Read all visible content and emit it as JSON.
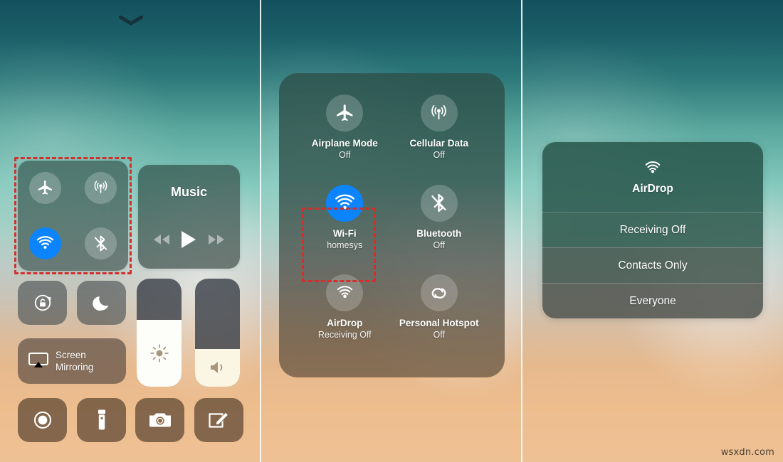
{
  "watermark": "wsxdn.com",
  "panel1": {
    "chevron_icon": "chevron-down-icon",
    "toggles": [
      {
        "id": "airplane",
        "icon": "airplane-icon",
        "state": "off"
      },
      {
        "id": "cellular",
        "icon": "cellular-antenna-icon",
        "state": "off"
      },
      {
        "id": "wifi",
        "icon": "wifi-icon",
        "state": "on"
      },
      {
        "id": "bluetooth",
        "icon": "bluetooth-off-icon",
        "state": "off"
      }
    ],
    "music": {
      "title": "Music",
      "prev_icon": "rewind-icon",
      "play_icon": "play-icon",
      "next_icon": "fast-forward-icon"
    },
    "rotation_lock": {
      "icon": "rotation-lock-icon"
    },
    "do_not_disturb": {
      "icon": "moon-icon"
    },
    "screen_mirroring": {
      "icon": "airplay-icon",
      "line1": "Screen",
      "line2": "Mirroring"
    },
    "brightness": {
      "icon": "brightness-sun-icon",
      "level_percent": 62
    },
    "volume": {
      "icon": "speaker-icon",
      "level_percent": 35
    },
    "bottom_row": [
      {
        "id": "screen-record",
        "icon": "screen-record-icon"
      },
      {
        "id": "flashlight",
        "icon": "flashlight-icon"
      },
      {
        "id": "camera",
        "icon": "camera-icon"
      },
      {
        "id": "notes",
        "icon": "notes-pencil-icon"
      }
    ]
  },
  "panel2": {
    "tiles": [
      {
        "id": "airplane-mode",
        "icon": "airplane-icon",
        "name": "Airplane Mode",
        "state": "Off",
        "active": false
      },
      {
        "id": "cellular-data",
        "icon": "cellular-antenna-icon",
        "name": "Cellular Data",
        "state": "Off",
        "active": false
      },
      {
        "id": "wifi",
        "icon": "wifi-icon",
        "name": "Wi-Fi",
        "state": "homesys",
        "active": true
      },
      {
        "id": "bluetooth",
        "icon": "bluetooth-off-icon",
        "name": "Bluetooth",
        "state": "Off",
        "active": false
      },
      {
        "id": "airdrop",
        "icon": "airdrop-icon",
        "name": "AirDrop",
        "state": "Receiving Off",
        "active": false
      },
      {
        "id": "personal-hotspot",
        "icon": "hotspot-icon",
        "name": "Personal Hotspot",
        "state": "Off",
        "active": false
      }
    ]
  },
  "panel3": {
    "menu": {
      "icon": "airdrop-icon",
      "title": "AirDrop",
      "options": [
        {
          "label": "Receiving Off",
          "selected": true
        },
        {
          "label": "Contacts Only",
          "selected": false
        },
        {
          "label": "Everyone",
          "selected": false
        }
      ]
    }
  },
  "colors": {
    "accent_blue": "#0b84fe",
    "highlight_red": "#d1302c",
    "wallpaper_top": "#13505d",
    "wallpaper_mid": "#84c9bd",
    "wallpaper_bottom": "#eec195"
  }
}
